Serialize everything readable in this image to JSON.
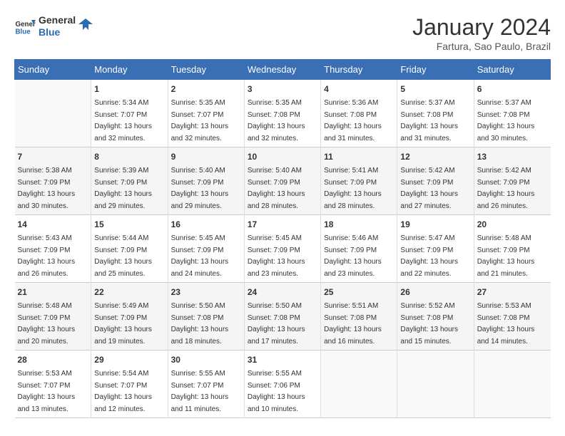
{
  "header": {
    "logo_line1": "General",
    "logo_line2": "Blue",
    "month": "January 2024",
    "location": "Fartura, Sao Paulo, Brazil"
  },
  "weekdays": [
    "Sunday",
    "Monday",
    "Tuesday",
    "Wednesday",
    "Thursday",
    "Friday",
    "Saturday"
  ],
  "weeks": [
    [
      {
        "day": "",
        "sunrise": "",
        "sunset": "",
        "daylight": ""
      },
      {
        "day": "1",
        "sunrise": "Sunrise: 5:34 AM",
        "sunset": "Sunset: 7:07 PM",
        "daylight": "Daylight: 13 hours and 32 minutes."
      },
      {
        "day": "2",
        "sunrise": "Sunrise: 5:35 AM",
        "sunset": "Sunset: 7:07 PM",
        "daylight": "Daylight: 13 hours and 32 minutes."
      },
      {
        "day": "3",
        "sunrise": "Sunrise: 5:35 AM",
        "sunset": "Sunset: 7:08 PM",
        "daylight": "Daylight: 13 hours and 32 minutes."
      },
      {
        "day": "4",
        "sunrise": "Sunrise: 5:36 AM",
        "sunset": "Sunset: 7:08 PM",
        "daylight": "Daylight: 13 hours and 31 minutes."
      },
      {
        "day": "5",
        "sunrise": "Sunrise: 5:37 AM",
        "sunset": "Sunset: 7:08 PM",
        "daylight": "Daylight: 13 hours and 31 minutes."
      },
      {
        "day": "6",
        "sunrise": "Sunrise: 5:37 AM",
        "sunset": "Sunset: 7:08 PM",
        "daylight": "Daylight: 13 hours and 30 minutes."
      }
    ],
    [
      {
        "day": "7",
        "sunrise": "Sunrise: 5:38 AM",
        "sunset": "Sunset: 7:09 PM",
        "daylight": "Daylight: 13 hours and 30 minutes."
      },
      {
        "day": "8",
        "sunrise": "Sunrise: 5:39 AM",
        "sunset": "Sunset: 7:09 PM",
        "daylight": "Daylight: 13 hours and 29 minutes."
      },
      {
        "day": "9",
        "sunrise": "Sunrise: 5:40 AM",
        "sunset": "Sunset: 7:09 PM",
        "daylight": "Daylight: 13 hours and 29 minutes."
      },
      {
        "day": "10",
        "sunrise": "Sunrise: 5:40 AM",
        "sunset": "Sunset: 7:09 PM",
        "daylight": "Daylight: 13 hours and 28 minutes."
      },
      {
        "day": "11",
        "sunrise": "Sunrise: 5:41 AM",
        "sunset": "Sunset: 7:09 PM",
        "daylight": "Daylight: 13 hours and 28 minutes."
      },
      {
        "day": "12",
        "sunrise": "Sunrise: 5:42 AM",
        "sunset": "Sunset: 7:09 PM",
        "daylight": "Daylight: 13 hours and 27 minutes."
      },
      {
        "day": "13",
        "sunrise": "Sunrise: 5:42 AM",
        "sunset": "Sunset: 7:09 PM",
        "daylight": "Daylight: 13 hours and 26 minutes."
      }
    ],
    [
      {
        "day": "14",
        "sunrise": "Sunrise: 5:43 AM",
        "sunset": "Sunset: 7:09 PM",
        "daylight": "Daylight: 13 hours and 26 minutes."
      },
      {
        "day": "15",
        "sunrise": "Sunrise: 5:44 AM",
        "sunset": "Sunset: 7:09 PM",
        "daylight": "Daylight: 13 hours and 25 minutes."
      },
      {
        "day": "16",
        "sunrise": "Sunrise: 5:45 AM",
        "sunset": "Sunset: 7:09 PM",
        "daylight": "Daylight: 13 hours and 24 minutes."
      },
      {
        "day": "17",
        "sunrise": "Sunrise: 5:45 AM",
        "sunset": "Sunset: 7:09 PM",
        "daylight": "Daylight: 13 hours and 23 minutes."
      },
      {
        "day": "18",
        "sunrise": "Sunrise: 5:46 AM",
        "sunset": "Sunset: 7:09 PM",
        "daylight": "Daylight: 13 hours and 23 minutes."
      },
      {
        "day": "19",
        "sunrise": "Sunrise: 5:47 AM",
        "sunset": "Sunset: 7:09 PM",
        "daylight": "Daylight: 13 hours and 22 minutes."
      },
      {
        "day": "20",
        "sunrise": "Sunrise: 5:48 AM",
        "sunset": "Sunset: 7:09 PM",
        "daylight": "Daylight: 13 hours and 21 minutes."
      }
    ],
    [
      {
        "day": "21",
        "sunrise": "Sunrise: 5:48 AM",
        "sunset": "Sunset: 7:09 PM",
        "daylight": "Daylight: 13 hours and 20 minutes."
      },
      {
        "day": "22",
        "sunrise": "Sunrise: 5:49 AM",
        "sunset": "Sunset: 7:09 PM",
        "daylight": "Daylight: 13 hours and 19 minutes."
      },
      {
        "day": "23",
        "sunrise": "Sunrise: 5:50 AM",
        "sunset": "Sunset: 7:08 PM",
        "daylight": "Daylight: 13 hours and 18 minutes."
      },
      {
        "day": "24",
        "sunrise": "Sunrise: 5:50 AM",
        "sunset": "Sunset: 7:08 PM",
        "daylight": "Daylight: 13 hours and 17 minutes."
      },
      {
        "day": "25",
        "sunrise": "Sunrise: 5:51 AM",
        "sunset": "Sunset: 7:08 PM",
        "daylight": "Daylight: 13 hours and 16 minutes."
      },
      {
        "day": "26",
        "sunrise": "Sunrise: 5:52 AM",
        "sunset": "Sunset: 7:08 PM",
        "daylight": "Daylight: 13 hours and 15 minutes."
      },
      {
        "day": "27",
        "sunrise": "Sunrise: 5:53 AM",
        "sunset": "Sunset: 7:08 PM",
        "daylight": "Daylight: 13 hours and 14 minutes."
      }
    ],
    [
      {
        "day": "28",
        "sunrise": "Sunrise: 5:53 AM",
        "sunset": "Sunset: 7:07 PM",
        "daylight": "Daylight: 13 hours and 13 minutes."
      },
      {
        "day": "29",
        "sunrise": "Sunrise: 5:54 AM",
        "sunset": "Sunset: 7:07 PM",
        "daylight": "Daylight: 13 hours and 12 minutes."
      },
      {
        "day": "30",
        "sunrise": "Sunrise: 5:55 AM",
        "sunset": "Sunset: 7:07 PM",
        "daylight": "Daylight: 13 hours and 11 minutes."
      },
      {
        "day": "31",
        "sunrise": "Sunrise: 5:55 AM",
        "sunset": "Sunset: 7:06 PM",
        "daylight": "Daylight: 13 hours and 10 minutes."
      },
      {
        "day": "",
        "sunrise": "",
        "sunset": "",
        "daylight": ""
      },
      {
        "day": "",
        "sunrise": "",
        "sunset": "",
        "daylight": ""
      },
      {
        "day": "",
        "sunrise": "",
        "sunset": "",
        "daylight": ""
      }
    ]
  ]
}
